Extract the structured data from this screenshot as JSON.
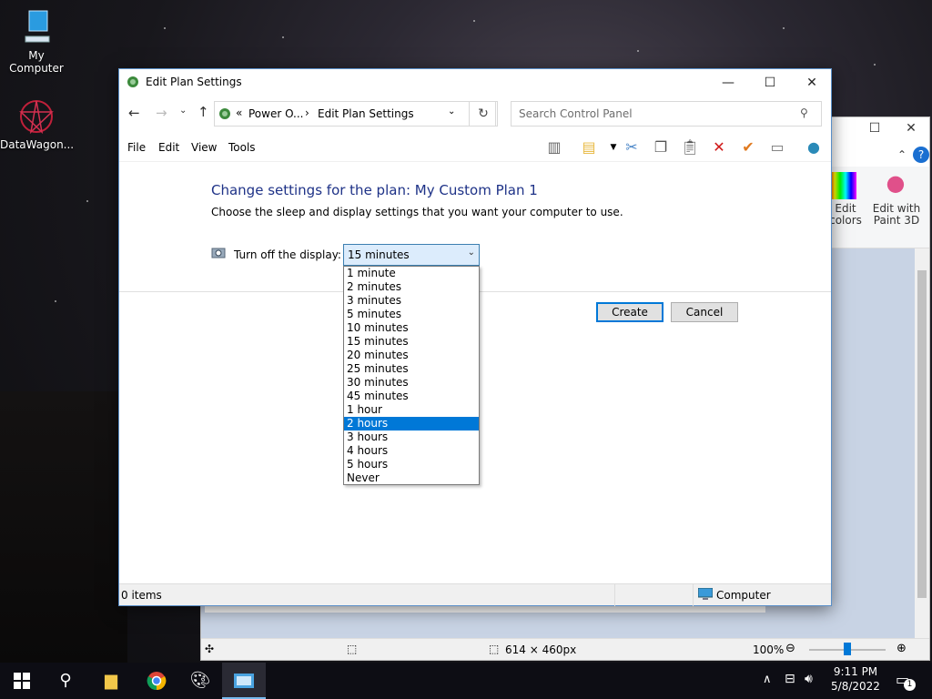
{
  "desktop": {
    "icons": [
      {
        "label": "My Computer",
        "icon": "computer-icon"
      },
      {
        "label": "DataWagon...",
        "icon": "datawagon-icon"
      }
    ]
  },
  "paint_window": {
    "ribbon": {
      "edit_colors": "Edit colors",
      "edit_paint3d": "Edit with Paint 3D"
    },
    "status": {
      "dimensions": "614 × 460px",
      "zoom": "100%"
    }
  },
  "window": {
    "title": "Edit Plan Settings",
    "buttons": {
      "minimize": "—",
      "maximize": "☐",
      "close": "✕"
    },
    "nav": {
      "breadcrumb_sep": "«",
      "breadcrumb_parent": "Power O...",
      "breadcrumb_arrow": "›",
      "breadcrumb_current": "Edit Plan Settings",
      "search_placeholder": "Search Control Panel"
    },
    "menu": [
      "File",
      "Edit",
      "View",
      "Tools"
    ],
    "content": {
      "heading": "Change settings for the plan: My Custom Plan 1",
      "description": "Choose the sleep and display settings that you want your computer to use.",
      "display_label": "Turn off the display:",
      "display_value": "15 minutes",
      "options": [
        "1 minute",
        "2 minutes",
        "3 minutes",
        "5 minutes",
        "10 minutes",
        "15 minutes",
        "20 minutes",
        "25 minutes",
        "30 minutes",
        "45 minutes",
        "1 hour",
        "2 hours",
        "3 hours",
        "4 hours",
        "5 hours",
        "Never"
      ],
      "highlighted_option": "2 hours",
      "create_label": "Create",
      "cancel_label": "Cancel"
    },
    "status": {
      "items": "0 items",
      "location": "Computer"
    }
  },
  "taskbar": {
    "time": "9:11 PM",
    "date": "5/8/2022",
    "notification_count": "1"
  }
}
